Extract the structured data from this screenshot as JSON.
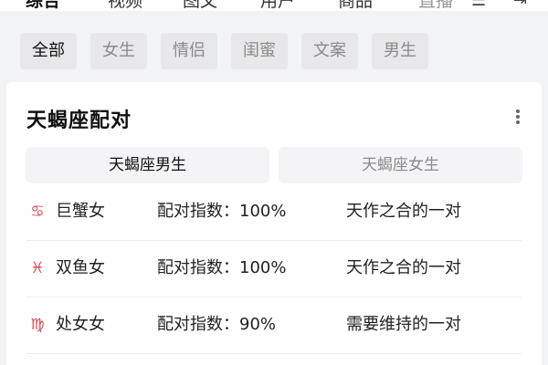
{
  "top_tabs": [
    {
      "label": "综合",
      "active": true
    },
    {
      "label": "视频",
      "active": false
    },
    {
      "label": "图文",
      "active": false
    },
    {
      "label": "用户",
      "active": false
    },
    {
      "label": "商品",
      "active": false
    },
    {
      "label": "直播",
      "active": false
    }
  ],
  "top_icons": [
    "filter-icon",
    "exit-icon"
  ],
  "chips": [
    {
      "label": "全部",
      "active": true
    },
    {
      "label": "女生",
      "active": false
    },
    {
      "label": "情侣",
      "active": false
    },
    {
      "label": "闺蜜",
      "active": false
    },
    {
      "label": "文案",
      "active": false
    },
    {
      "label": "男生",
      "active": false
    }
  ],
  "card": {
    "title": "天蝎座配对",
    "segments": [
      {
        "label": "天蝎座男生",
        "active": true
      },
      {
        "label": "天蝎座女生",
        "active": false
      }
    ],
    "rows": [
      {
        "icon": "cancer-icon",
        "glyph": "♋",
        "name": "巨蟹女",
        "score": "配对指数：100%",
        "desc": "天作之合的一对"
      },
      {
        "icon": "pisces-icon",
        "glyph": "♓",
        "name": "双鱼女",
        "score": "配对指数：100%",
        "desc": "天作之合的一对"
      },
      {
        "icon": "virgo-icon",
        "glyph": "♍",
        "name": "处女女",
        "score": "配对指数：90%",
        "desc": "需要维持的一对"
      }
    ]
  },
  "colors": {
    "page_bg": "#f2f3f5",
    "chip_bg": "#e8e8ea",
    "zodiac_accent": "#e0454a"
  }
}
